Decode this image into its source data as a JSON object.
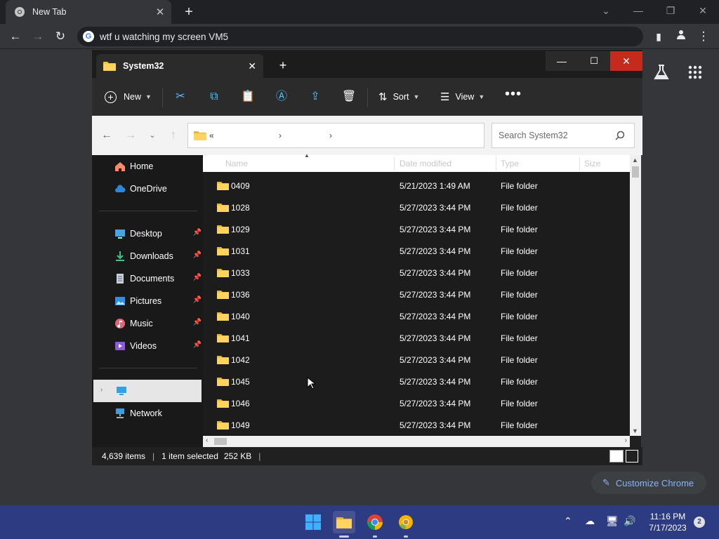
{
  "chrome": {
    "tab_title": "New Tab",
    "omnibox_text": "wtf u watching my screen VM5",
    "customize_label": "Customize Chrome"
  },
  "explorer": {
    "tab_title": "System32",
    "toolbar": {
      "new_label": "New",
      "sort_label": "Sort",
      "view_label": "View"
    },
    "address": {
      "prefix": "«"
    },
    "search_placeholder": "Search System32",
    "nav": {
      "home": "Home",
      "onedrive": "OneDrive",
      "desktop": "Desktop",
      "downloads": "Downloads",
      "documents": "Documents",
      "pictures": "Pictures",
      "music": "Music",
      "videos": "Videos",
      "network": "Network"
    },
    "columns": {
      "name": "Name",
      "date": "Date modified",
      "type": "Type",
      "size": "Size"
    },
    "rows": [
      {
        "name": "0409",
        "date": "5/21/2023 1:49 AM",
        "type": "File folder"
      },
      {
        "name": "1028",
        "date": "5/27/2023 3:44 PM",
        "type": "File folder"
      },
      {
        "name": "1029",
        "date": "5/27/2023 3:44 PM",
        "type": "File folder"
      },
      {
        "name": "1031",
        "date": "5/27/2023 3:44 PM",
        "type": "File folder"
      },
      {
        "name": "1033",
        "date": "5/27/2023 3:44 PM",
        "type": "File folder"
      },
      {
        "name": "1036",
        "date": "5/27/2023 3:44 PM",
        "type": "File folder"
      },
      {
        "name": "1040",
        "date": "5/27/2023 3:44 PM",
        "type": "File folder"
      },
      {
        "name": "1041",
        "date": "5/27/2023 3:44 PM",
        "type": "File folder"
      },
      {
        "name": "1042",
        "date": "5/27/2023 3:44 PM",
        "type": "File folder"
      },
      {
        "name": "1045",
        "date": "5/27/2023 3:44 PM",
        "type": "File folder"
      },
      {
        "name": "1046",
        "date": "5/27/2023 3:44 PM",
        "type": "File folder"
      },
      {
        "name": "1049",
        "date": "5/27/2023 3:44 PM",
        "type": "File folder"
      }
    ],
    "status": {
      "items": "4,639 items",
      "selected": "1 item selected",
      "size": "252 KB"
    }
  },
  "taskbar": {
    "time": "11:16 PM",
    "date": "7/17/2023",
    "notifications": "2"
  }
}
